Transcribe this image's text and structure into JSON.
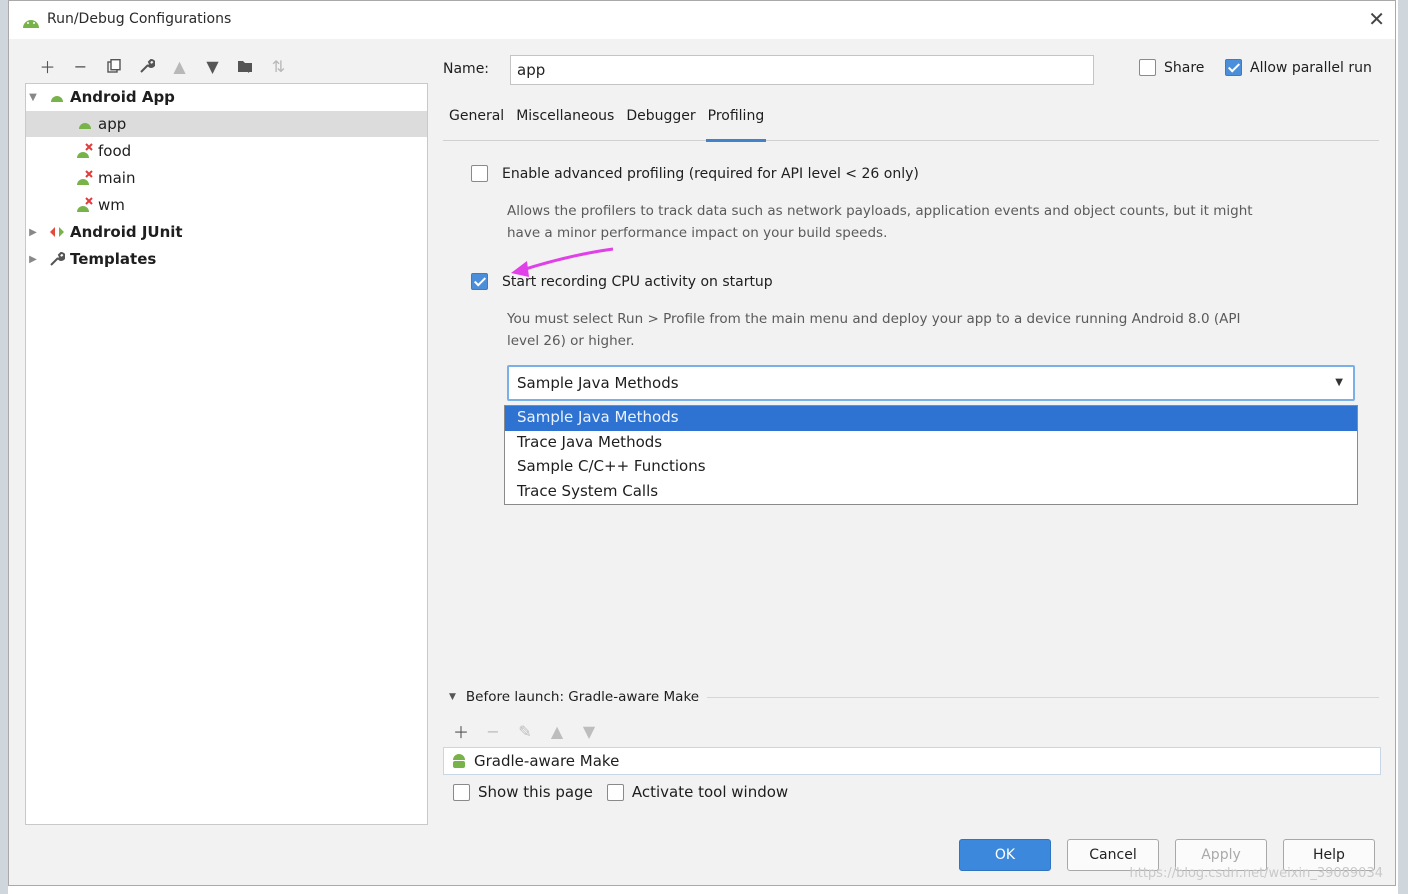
{
  "window": {
    "title": "Run/Debug Configurations"
  },
  "left_toolbar": {
    "buttons": [
      "add",
      "remove",
      "copy",
      "edit-templates",
      "move-up",
      "move-down",
      "move-to-folder",
      "sort"
    ]
  },
  "tree": {
    "items": [
      {
        "label": "Android App",
        "level": 0,
        "expanded": true,
        "bold": true,
        "icon": "android-icon"
      },
      {
        "label": "app",
        "level": 1,
        "selected": true,
        "icon": "android-icon"
      },
      {
        "label": "food",
        "level": 1,
        "icon": "android-error-icon"
      },
      {
        "label": "main",
        "level": 1,
        "icon": "android-error-icon"
      },
      {
        "label": "wm",
        "level": 1,
        "icon": "android-error-icon"
      },
      {
        "label": "Android JUnit",
        "level": 0,
        "expanded": false,
        "bold": true,
        "icon": "junit-icon"
      },
      {
        "label": "Templates",
        "level": 0,
        "expanded": false,
        "bold": true,
        "icon": "wrench-icon"
      }
    ]
  },
  "config": {
    "name_label": "Name:",
    "name_value": "app",
    "share_label": "Share",
    "share_checked": false,
    "parallel_label": "Allow parallel run",
    "parallel_checked": true
  },
  "tabs": [
    "General",
    "Miscellaneous",
    "Debugger",
    "Profiling"
  ],
  "active_tab": "Profiling",
  "profiling": {
    "advanced_label": "Enable advanced profiling (required for API level < 26 only)",
    "advanced_checked": false,
    "advanced_desc_1": "Allows the profilers to track data such as network payloads, application events and object counts, but it might",
    "advanced_desc_2": "have a minor performance impact on your build speeds.",
    "cpu_label": "Start recording CPU activity on startup",
    "cpu_checked": true,
    "cpu_desc_1": "You must select Run > Profile from the main menu and deploy your app to a device running Android 8.0 (API",
    "cpu_desc_2": "level 26) or higher.",
    "combo_value": "Sample Java Methods",
    "options": [
      "Sample Java Methods",
      "Trace Java Methods",
      "Sample C/C++ Functions",
      "Trace System Calls"
    ],
    "selected_option": 0
  },
  "annotation_color": "#e040e8",
  "before_launch": {
    "title": "Before launch: Gradle-aware Make",
    "tasks": [
      "Gradle-aware Make"
    ],
    "show_page_label": "Show this page",
    "activate_label": "Activate tool window"
  },
  "buttons": {
    "ok": "OK",
    "cancel": "Cancel",
    "apply": "Apply",
    "help": "Help"
  },
  "watermark": "https://blog.csdn.net/weixin_39089034"
}
